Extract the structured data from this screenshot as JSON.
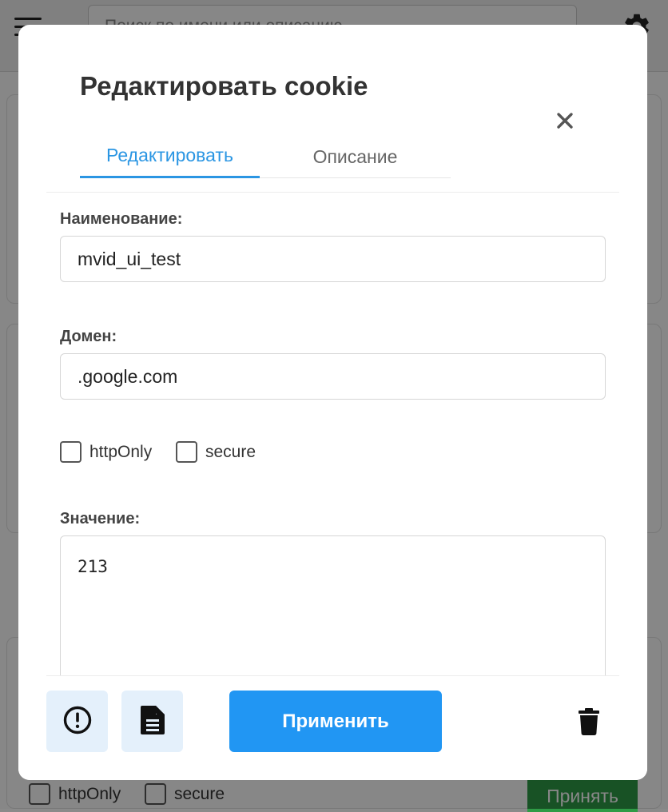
{
  "background": {
    "search_placeholder": "Поиск по имени или описанию",
    "httponly_label": "httpOnly",
    "secure_label": "secure",
    "accept_label": "Принять"
  },
  "modal": {
    "title": "Редактировать cookie",
    "tabs": [
      {
        "label": "Редактировать",
        "active": true
      },
      {
        "label": "Описание",
        "active": false
      }
    ],
    "fields": {
      "name_label": "Наименование:",
      "name_value": "mvid_ui_test",
      "domain_label": "Домен:",
      "domain_value": ".google.com",
      "httponly_label": "httpOnly",
      "httponly_checked": false,
      "secure_label": "secure",
      "secure_checked": false,
      "value_label": "Значение:",
      "value_value": "213"
    },
    "footer": {
      "apply_label": "Применить"
    }
  },
  "icons": {
    "menu": "menu-icon",
    "settings": "gear-icon",
    "close": "close-icon",
    "info": "exclamation-circle-icon",
    "document": "document-icon",
    "delete": "trash-icon"
  },
  "colors": {
    "accent": "#2196f3",
    "tab_active": "#2b96e3",
    "icon_button_bg": "#e4f0fb",
    "accept_button": "#2f9b46"
  }
}
